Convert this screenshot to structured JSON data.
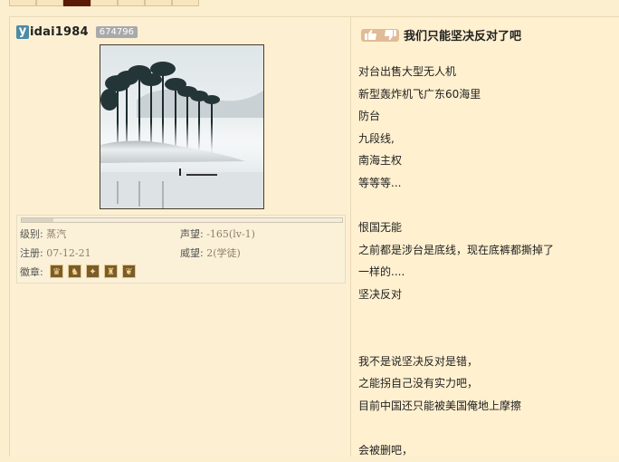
{
  "user": {
    "icon_letter": "y",
    "name": "idai1984",
    "uid": "674796"
  },
  "stats": {
    "level_label": "级别:",
    "level_value": "蒸汽",
    "reputation_label": "声望:",
    "reputation_value": "-165(lv-1)",
    "register_label": "注册:",
    "register_value": "07-12-21",
    "prestige_label": "威望:",
    "prestige_value": "2(学徒)",
    "badges_label": "徽章:",
    "level_progress": 0.1,
    "badges": [
      "badge-1-icon",
      "badge-2-icon",
      "badge-3-icon",
      "badge-4-icon",
      "badge-5-icon"
    ]
  },
  "post": {
    "title": "我们只能坚决反对了吧",
    "lines": [
      "对台出售大型无人机",
      "新型轰炸机飞广东60海里",
      "防台",
      "九段线,",
      "南海主权",
      "等等等...",
      "",
      "恨国无能",
      "之前都是涉台是底线，现在底裤都撕掉了",
      "一样的....",
      "坚决反对",
      "",
      "",
      "我不是说坚决反对是错，",
      "之能拐自己没有实力吧，",
      "目前中国还只能被美国俺地上摩擦",
      "",
      "会被删吧，"
    ]
  },
  "colors": {
    "page_bg": "#fbefd0",
    "accent_tab": "#5b1c06",
    "uid_badge": "#a9a9a9",
    "user_icon": "#4d8aa4"
  }
}
